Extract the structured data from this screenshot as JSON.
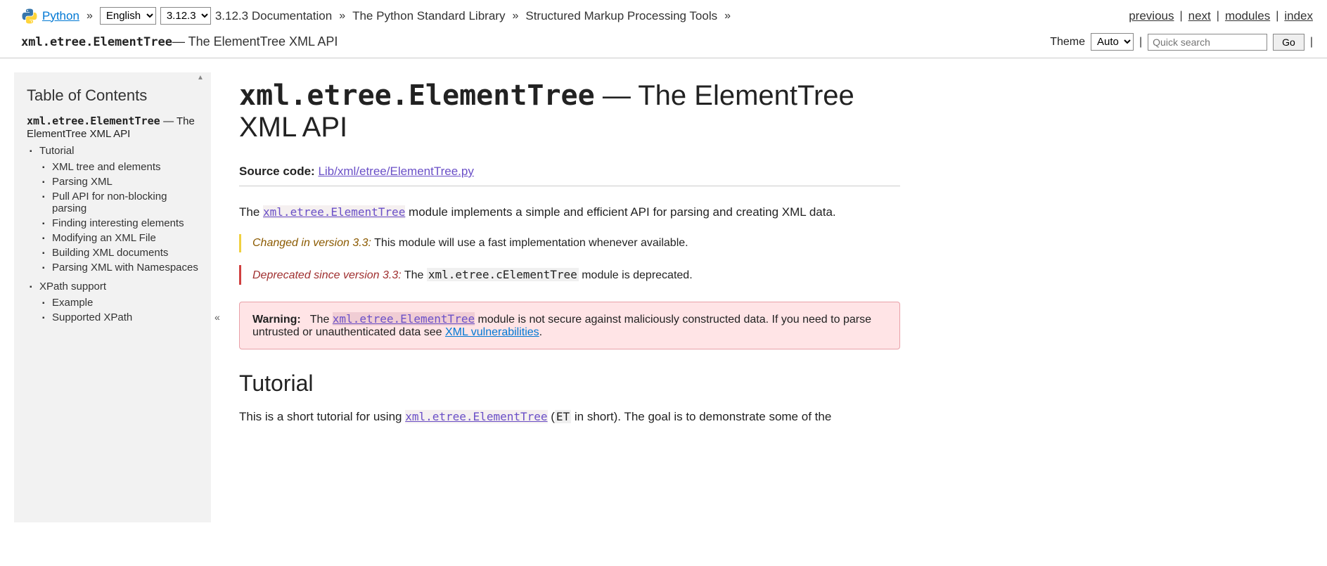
{
  "topbar": {
    "python_label": "Python",
    "language_selected": "English",
    "version_selected": "3.12.3",
    "breadcrumbs": [
      "3.12.3 Documentation",
      "The Python Standard Library",
      "Structured Markup Processing Tools"
    ],
    "nav": {
      "previous": "previous",
      "next": "next",
      "modules": "modules",
      "index": "index"
    }
  },
  "subbar": {
    "module_name": "xml.etree.ElementTree",
    "dash_title": " — The ElementTree XML API",
    "theme_label": "Theme",
    "theme_selected": "Auto",
    "search_placeholder": "Quick search",
    "go_label": "Go"
  },
  "toc": {
    "heading": "Table of Contents",
    "root_mod": "xml.etree.ElementTree",
    "root_suffix": " — The ElementTree XML API",
    "tutorial": "Tutorial",
    "tutorial_children": [
      "XML tree and elements",
      "Parsing XML",
      "Pull API for non-blocking parsing",
      "Finding interesting elements",
      "Modifying an XML File",
      "Building XML documents",
      "Parsing XML with Namespaces"
    ],
    "xpath": "XPath support",
    "xpath_children": [
      "Example",
      "Supported XPath"
    ]
  },
  "main": {
    "title_mono": "xml.etree.ElementTree",
    "title_rest": " — The ElementTree XML API",
    "source_label": "Source code:",
    "source_link_text": "Lib/xml/etree/ElementTree.py",
    "intro_pre": "The ",
    "intro_code": "xml.etree.ElementTree",
    "intro_post": " module implements a simple and efficient API for parsing and creating XML data.",
    "changed_label": "Changed in version 3.3:",
    "changed_text": " This module will use a fast implementation whenever available.",
    "deprecated_label": "Deprecated since version 3.3:",
    "deprecated_pre": " The ",
    "deprecated_code": "xml.etree.cElementTree",
    "deprecated_post": " module is deprecated.",
    "warning_label": "Warning:",
    "warning_pre": " The ",
    "warning_code": "xml.etree.ElementTree",
    "warning_mid": " module is not secure against maliciously constructed data. If you need to parse untrusted or unauthenticated data see ",
    "warning_link": "XML vulnerabilities",
    "warning_post": ".",
    "tutorial_heading": "Tutorial",
    "tutorial_p_pre": "This is a short tutorial for using ",
    "tutorial_p_code": "xml.etree.ElementTree",
    "tutorial_p_mid": " (",
    "tutorial_p_et": "ET",
    "tutorial_p_post": " in short). The goal is to demonstrate some of the"
  }
}
